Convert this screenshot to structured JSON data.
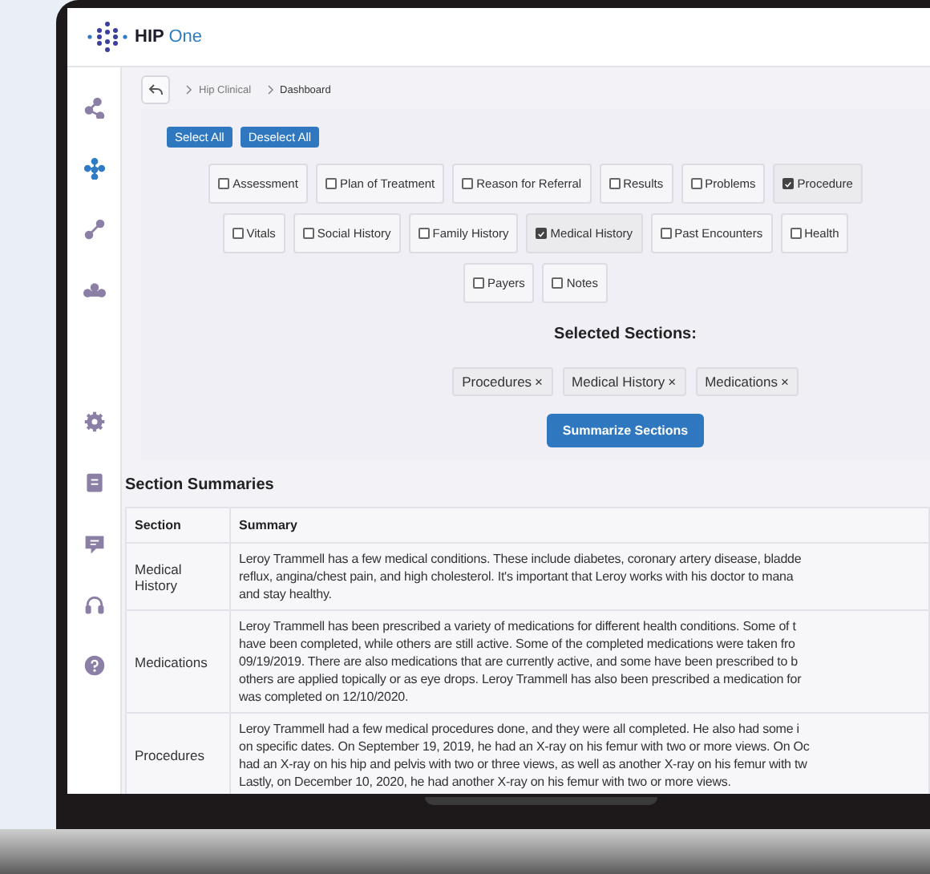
{
  "app": {
    "brand": "HIP",
    "brand_suffix": "One"
  },
  "sidebar": {
    "items": [
      {
        "selected": false
      },
      {
        "selected": true
      },
      {
        "selected": false
      },
      {
        "selected": false
      },
      {
        "selected": false
      },
      {
        "selected": false
      },
      {
        "selected": false
      },
      {
        "selected": false
      },
      {
        "selected": false
      }
    ]
  },
  "breadcrumb": [
    "Hip Clinical",
    "Dashboard"
  ],
  "bulk_buttons": [
    "Select All",
    "Deselect All"
  ],
  "section_rows": [
    {
      "options": [
        {
          "label": "Assessment",
          "checked": false
        },
        {
          "label": "Plan of Treatment",
          "checked": false
        },
        {
          "label": "Reason for Referral",
          "checked": false
        },
        {
          "label": "Results",
          "checked": false
        },
        {
          "label": "Problems",
          "checked": false
        },
        {
          "label": "Procedure",
          "checked": true
        }
      ]
    },
    {
      "options": [
        {
          "label": "Vitals",
          "checked": false
        },
        {
          "label": "Social History",
          "checked": false
        },
        {
          "label": "Family History",
          "checked": false
        },
        {
          "label": "Medical History",
          "checked": true
        },
        {
          "label": "Past Encounters",
          "checked": false
        },
        {
          "label": "Health",
          "checked": false
        }
      ]
    },
    {
      "options": [
        {
          "label": "Payers",
          "checked": false
        },
        {
          "label": "Notes",
          "checked": false
        }
      ]
    }
  ],
  "selected_title": "Selected Sections:",
  "selected_sections": [
    {
      "label": "Procedures",
      "remove": "×"
    },
    {
      "label": "Medical History",
      "remove": "×"
    },
    {
      "label": "Medications",
      "remove": "×"
    }
  ],
  "summarize_button": "Summarize Sections",
  "summaries_title": "Section Summaries",
  "table": {
    "columns": [
      "Section",
      "Summary"
    ],
    "rows": [
      {
        "section": "Medical History",
        "summary_lines": [
          "Leroy Trammell has a few medical conditions. These include diabetes, coronary artery disease, bladde",
          "reflux, angina/chest pain, and high cholesterol. It's important that Leroy works with his doctor to mana",
          "and stay healthy."
        ]
      },
      {
        "section": "Medications",
        "summary_lines": [
          "Leroy Trammell has been prescribed a variety of medications for different health conditions. Some of t",
          "have been completed, while others are still active. Some of the completed medications were taken fro",
          "09/19/2019. There are also medications that are currently active, and some have been prescribed to b",
          "others are applied topically or as eye drops. Leroy Trammell has also been prescribed a medication for",
          "was completed on 12/10/2020."
        ]
      },
      {
        "section": "Procedures",
        "summary_lines": [
          "Leroy Trammell had a few medical procedures done, and they were all completed. He also had some i",
          "on specific dates. On September 19, 2019, he had an X-ray on his femur with two or more views. On Oc",
          "had an X-ray on his hip and pelvis with two or three views, as well as another X-ray on his femur with tw",
          "Lastly, on December 10, 2020, he had another X-ray on his femur with two or more views."
        ]
      }
    ]
  }
}
